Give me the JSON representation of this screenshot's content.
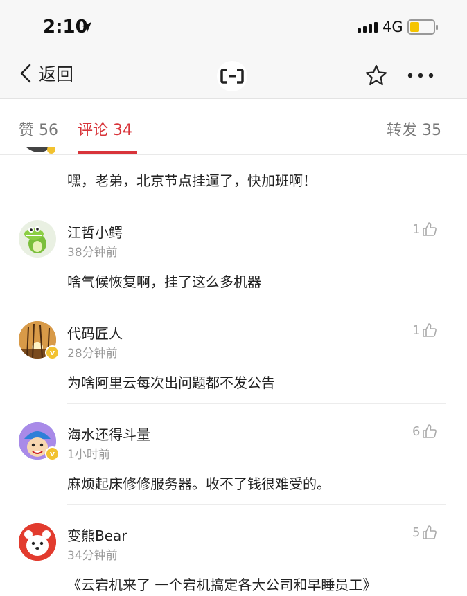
{
  "status_bar": {
    "time": "2:10",
    "network": "4G"
  },
  "nav": {
    "back_label": "返回"
  },
  "tabs": [
    {
      "label": "赞 56"
    },
    {
      "label": "评论 34",
      "active": true
    },
    {
      "label": "转发 35"
    }
  ],
  "colors": {
    "accent": "#d8343a",
    "battery": "#f5c400"
  },
  "comments": [
    {
      "text": "嘿，老弟，北京节点挂逼了，快加班啊！"
    },
    {
      "user": "江哲小鳄",
      "time": "38分钟前",
      "likes": "1",
      "text": "啥气候恢复啊，挂了这么多机器"
    },
    {
      "user": "代码匠人",
      "time": "28分钟前",
      "likes": "1",
      "text": "为啥阿里云每次出问题都不发公告",
      "verified": "v"
    },
    {
      "user": "海水还得斗量",
      "time": "1小时前",
      "likes": "6",
      "text": "麻烦起床修修服务器。收不了钱很难受的。",
      "verified": "v"
    },
    {
      "user": "变熊Bear",
      "time": "34分钟前",
      "likes": "5",
      "text": "《云宕机来了 一个宕机搞定各大公司和早睡员工》"
    }
  ]
}
